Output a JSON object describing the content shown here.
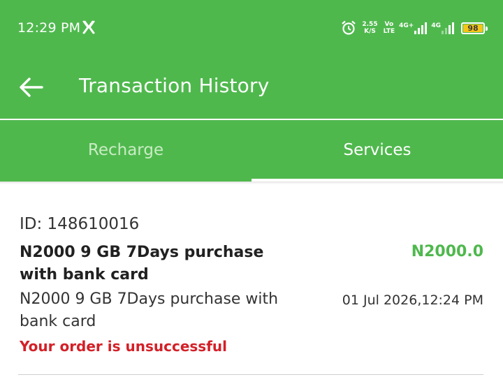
{
  "status_bar": {
    "time": "12:29 PM",
    "notification_icon": "x-icon",
    "net_speed_value": "2.55",
    "net_speed_unit": "K/S",
    "volte_top": "Vo",
    "volte_bottom": "LTE",
    "sim1_network": "4G+",
    "sim2_network": "4G",
    "battery_level": "98"
  },
  "header": {
    "back_icon": "arrow-left-icon",
    "title": "Transaction History"
  },
  "tabs": [
    {
      "label": "Recharge",
      "active": false
    },
    {
      "label": "Services",
      "active": true
    }
  ],
  "transactions": [
    {
      "id_text": "ID: 148610016",
      "title": "N2000 9 GB 7Days purchase with bank card",
      "amount": "N2000.0",
      "description": "N2000 9 GB 7Days purchase with bank card",
      "datetime": "01 Jul 2026,12:24 PM",
      "status": "Your order is unsuccessful"
    }
  ],
  "colors": {
    "brand_green": "#4fb84d",
    "inactive_tab_text": "#c9ecc4",
    "amount_green": "#4fb84d",
    "error_red": "#d32027",
    "battery_fill": "#f5c518"
  }
}
